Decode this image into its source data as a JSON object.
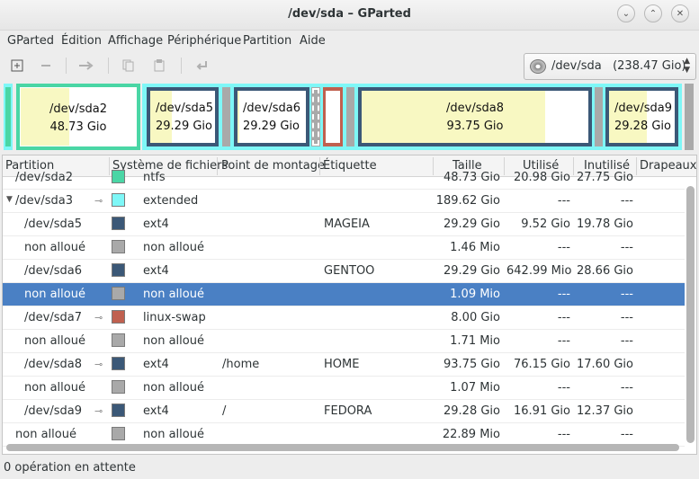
{
  "window": {
    "title": "/dev/sda – GParted",
    "minimize_glyph": "⌄",
    "maximize_glyph": "⌃",
    "close_glyph": "✕"
  },
  "menu": [
    "GParted",
    "Édition",
    "Affichage",
    "Périphérique",
    "Partition",
    "Aide"
  ],
  "toolbar": {
    "icons": [
      "new-icon",
      "delete-icon",
      "resize-move-icon",
      "copy-icon",
      "paste-icon",
      "undo-icon"
    ],
    "device_select": "/dev/sda   (238.47 Gio)"
  },
  "diskmap": [
    {
      "name": "/dev/sda2",
      "size": "48.73 Gio",
      "used_fraction": 0.42,
      "color": "#4ad6a5"
    },
    {
      "name": "/dev/sda5",
      "size": "29.29 Gio",
      "used_fraction": 0.33,
      "color": "#3b5877"
    },
    {
      "name": "/dev/sda6",
      "size": "29.29 Gio",
      "used_fraction": 0.98,
      "color": "#3b5877"
    },
    {
      "name": "",
      "size": "",
      "used_fraction": 1.0,
      "color": "#c0604f"
    },
    {
      "name": "/dev/sda8",
      "size": "93.75 Gio",
      "used_fraction": 0.81,
      "color": "#3b5877"
    },
    {
      "name": "/dev/sda9",
      "size": "29.28 Gio",
      "used_fraction": 0.58,
      "color": "#3b5877"
    }
  ],
  "table": {
    "headers": [
      "Partition",
      "Système de fichiers",
      "Point de montage",
      "Étiquette",
      "Taille",
      "Utilisé",
      "Inutilisé",
      "Drapeaux"
    ],
    "rows": [
      {
        "partition": "/dev/sda2",
        "fs": "ntfs",
        "mount": "",
        "label": "",
        "size": "48.73 Gio",
        "used": "20.98 Gio",
        "unused": "27.75 Gio",
        "color": "#4ad6a5",
        "key": false
      },
      {
        "partition": "/dev/sda3",
        "fs": "extended",
        "mount": "",
        "label": "",
        "size": "189.62 Gio",
        "used": "---",
        "unused": "---",
        "color": "#7ef7f7",
        "key": true
      },
      {
        "partition": "/dev/sda5",
        "fs": "ext4",
        "mount": "",
        "label": "MAGEIA",
        "size": "29.29 Gio",
        "used": "9.52 Gio",
        "unused": "19.78 Gio",
        "color": "#3b5877",
        "key": false
      },
      {
        "partition": "non alloué",
        "fs": "non alloué",
        "mount": "",
        "label": "",
        "size": "1.46 Mio",
        "used": "---",
        "unused": "---",
        "color": "#a9a9a9",
        "key": false
      },
      {
        "partition": "/dev/sda6",
        "fs": "ext4",
        "mount": "",
        "label": "GENTOO",
        "size": "29.29 Gio",
        "used": "642.99 Mio",
        "unused": "28.66 Gio",
        "color": "#3b5877",
        "key": false
      },
      {
        "partition": "non alloué",
        "fs": "non alloué",
        "mount": "",
        "label": "",
        "size": "1.09 Mio",
        "used": "---",
        "unused": "---",
        "color": "#a9a9a9",
        "key": false
      },
      {
        "partition": "/dev/sda7",
        "fs": "linux-swap",
        "mount": "",
        "label": "",
        "size": "8.00 Gio",
        "used": "---",
        "unused": "---",
        "color": "#c0604f",
        "key": true
      },
      {
        "partition": "non alloué",
        "fs": "non alloué",
        "mount": "",
        "label": "",
        "size": "1.71 Mio",
        "used": "---",
        "unused": "---",
        "color": "#a9a9a9",
        "key": false
      },
      {
        "partition": "/dev/sda8",
        "fs": "ext4",
        "mount": "/home",
        "label": "HOME",
        "size": "93.75 Gio",
        "used": "76.15 Gio",
        "unused": "17.60 Gio",
        "color": "#3b5877",
        "key": true
      },
      {
        "partition": "non alloué",
        "fs": "non alloué",
        "mount": "",
        "label": "",
        "size": "1.07 Mio",
        "used": "---",
        "unused": "---",
        "color": "#a9a9a9",
        "key": false
      },
      {
        "partition": "/dev/sda9",
        "fs": "ext4",
        "mount": "/",
        "label": "FEDORA",
        "size": "29.28 Gio",
        "used": "16.91 Gio",
        "unused": "12.37 Gio",
        "color": "#3b5877",
        "key": true
      },
      {
        "partition": "non alloué",
        "fs": "non alloué",
        "mount": "",
        "label": "",
        "size": "22.89 Mio",
        "used": "---",
        "unused": "---",
        "color": "#a9a9a9",
        "key": false
      }
    ]
  },
  "status": "0 opération en attente"
}
